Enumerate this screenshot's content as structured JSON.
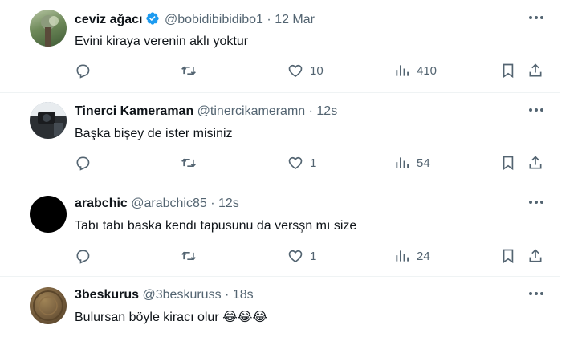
{
  "posts": [
    {
      "name": "ceviz ağacı",
      "verified": true,
      "handle": "@bobidibibidibo1",
      "separator": "·",
      "time": "12 Mar",
      "text": "Evini kiraya verenin aklı yoktur",
      "replies": "",
      "reposts": "",
      "likes": "10",
      "views": "410"
    },
    {
      "name": "Tinerci Kameraman",
      "verified": false,
      "handle": "@tinercikameramn",
      "separator": "·",
      "time": "12s",
      "text": "Başka bişey de ister misiniz",
      "replies": "",
      "reposts": "",
      "likes": "1",
      "views": "54"
    },
    {
      "name": "arabchic",
      "verified": false,
      "handle": "@arabchic85",
      "separator": "·",
      "time": "12s",
      "text": "Tabı tabı baska kendı tapusunu da versşn mı size",
      "replies": "",
      "reposts": "",
      "likes": "1",
      "views": "24"
    },
    {
      "name": "3beskurus",
      "verified": false,
      "handle": "@3beskuruss",
      "separator": "·",
      "time": "18s",
      "text": "Bulursan böyle kiracı olur 😂😂😂"
    }
  ],
  "colors": {
    "text": "#0f1419",
    "secondary": "#536471",
    "verified": "#1d9bf0",
    "divider": "#eff3f4"
  },
  "icons": [
    "verified-badge-icon",
    "more-icon",
    "reply-icon",
    "repost-icon",
    "like-icon",
    "views-icon",
    "bookmark-icon",
    "share-icon"
  ]
}
